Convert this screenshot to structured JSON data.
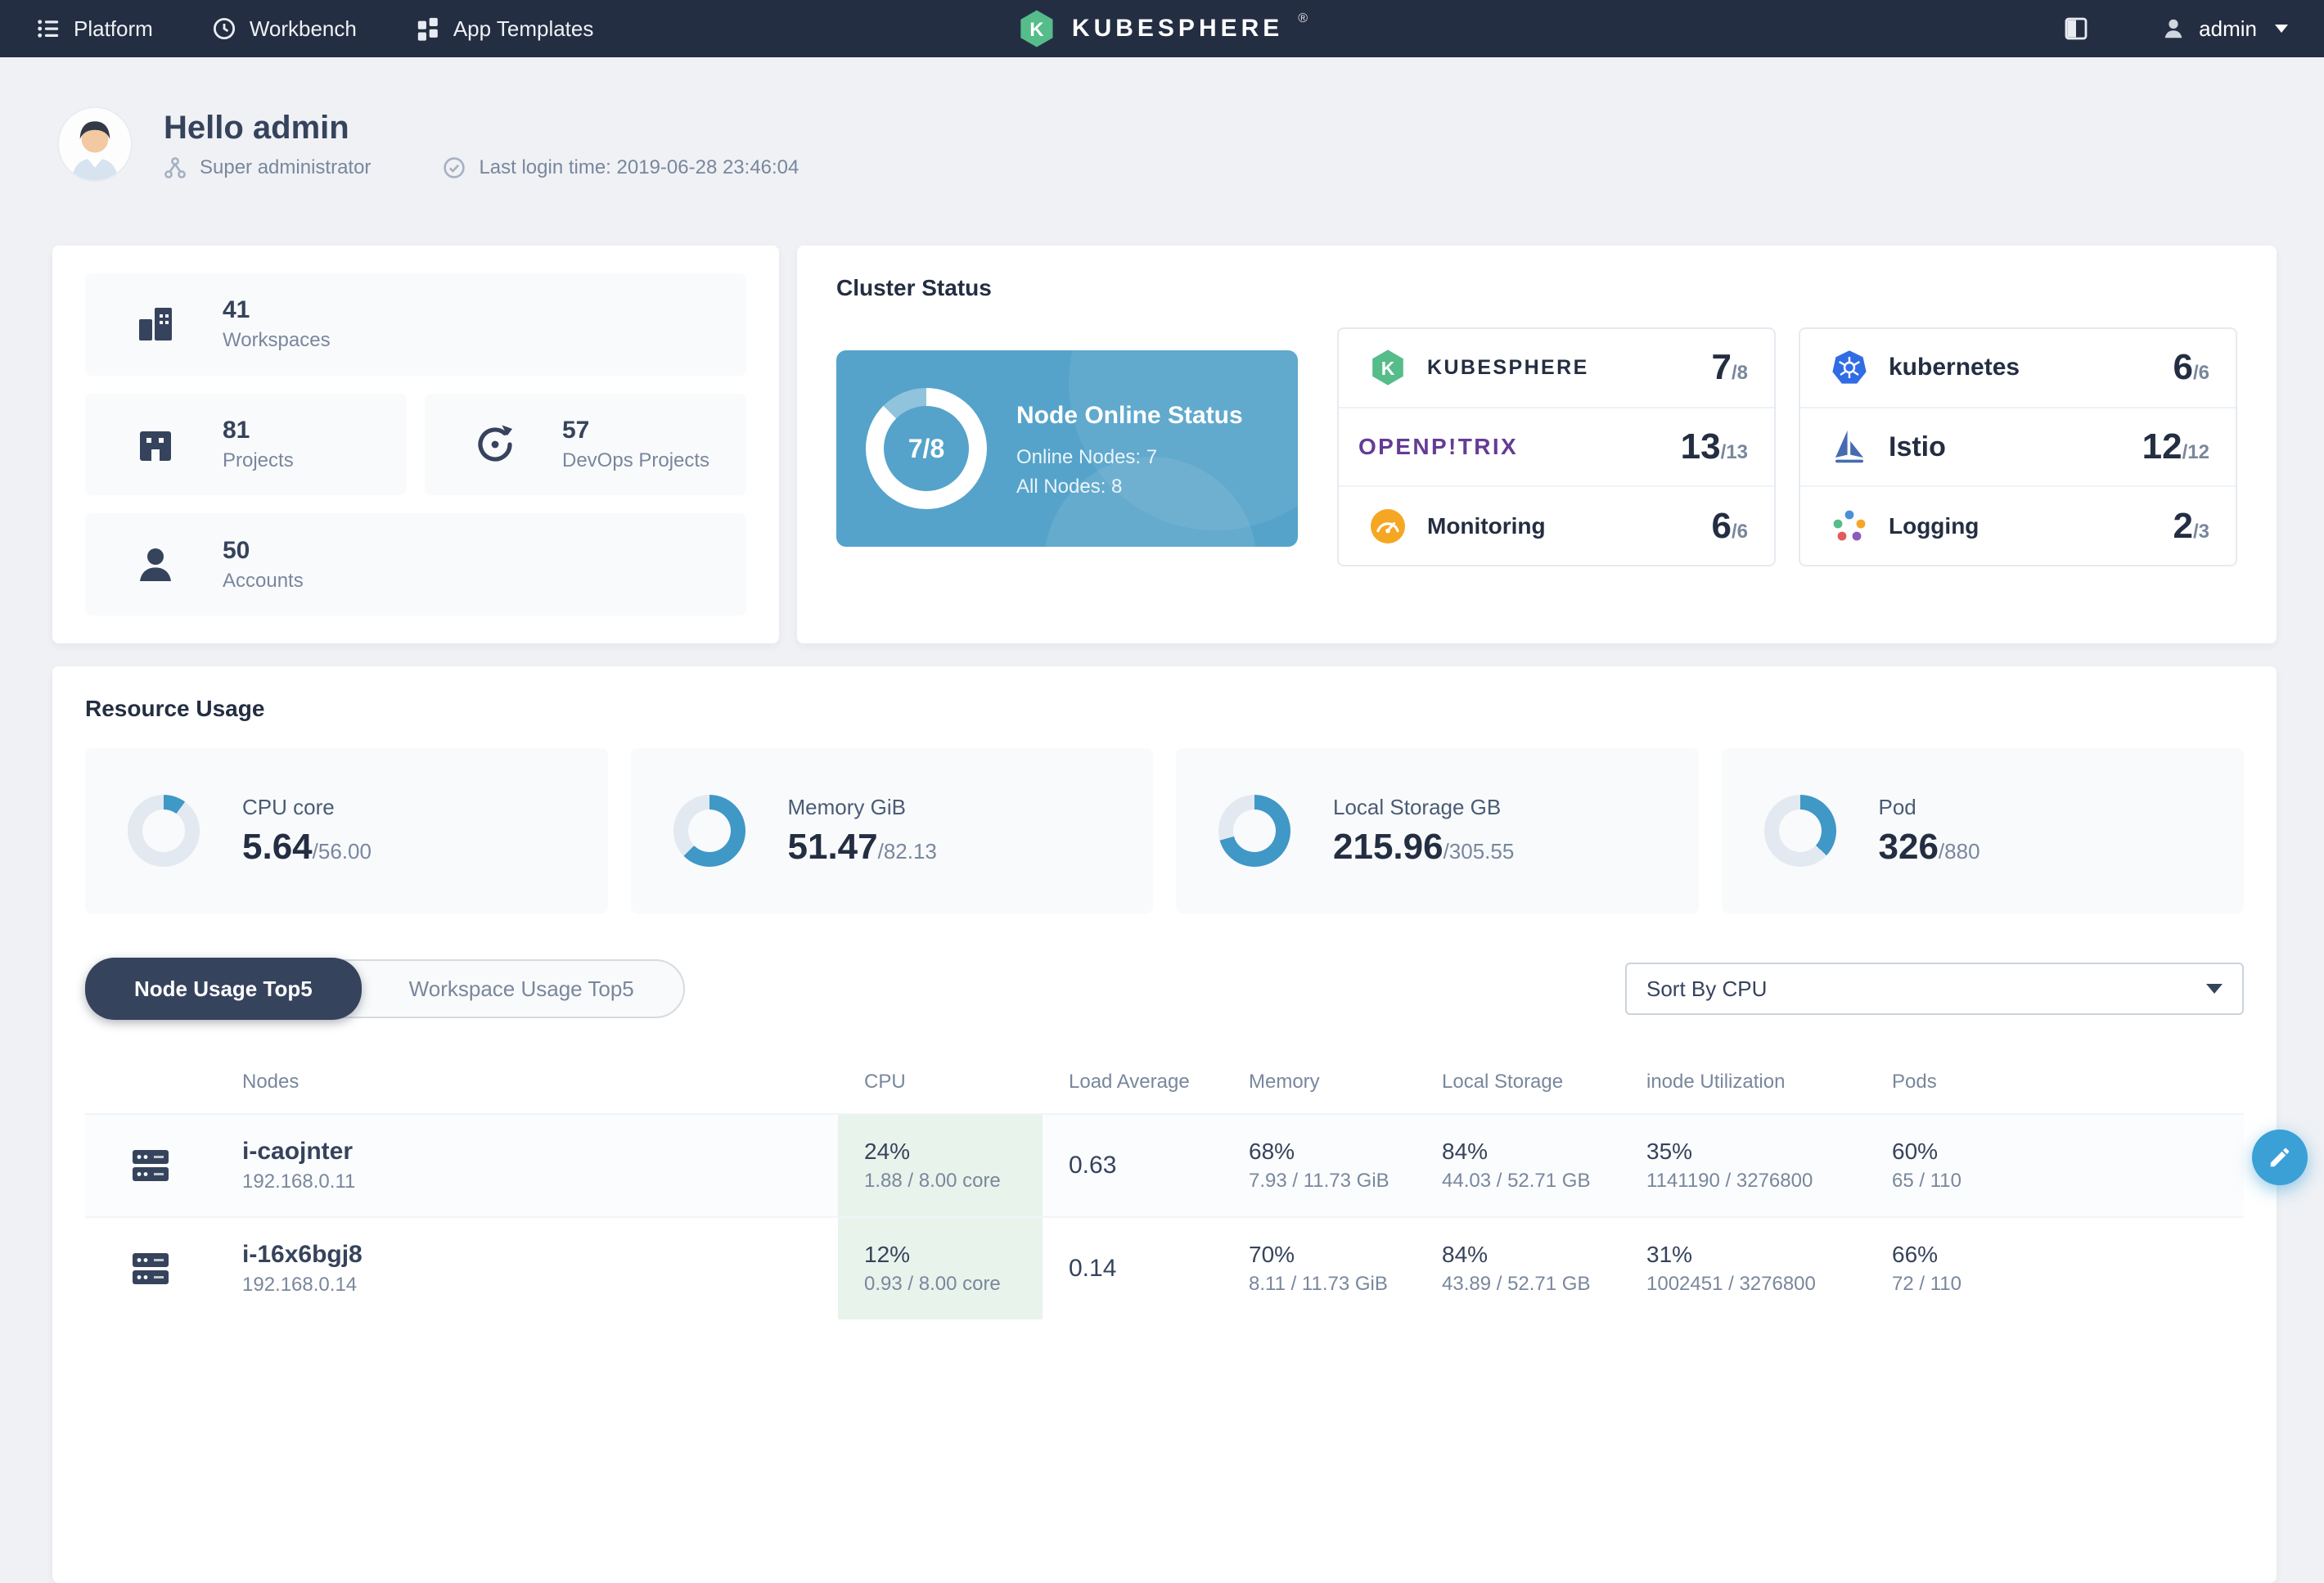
{
  "navbar": {
    "platform": "Platform",
    "workbench": "Workbench",
    "app_templates": "App Templates",
    "brand": "KUBESPHERE",
    "registered": "®",
    "user": "admin"
  },
  "header": {
    "greeting": "Hello admin",
    "role": "Super administrator",
    "last_login": "Last login time: 2019-06-28 23:46:04"
  },
  "stats": {
    "workspaces": {
      "value": "41",
      "label": "Workspaces"
    },
    "projects": {
      "value": "81",
      "label": "Projects"
    },
    "devops": {
      "value": "57",
      "label": "DevOps Projects"
    },
    "accounts": {
      "value": "50",
      "label": "Accounts"
    }
  },
  "cluster": {
    "title": "Cluster Status",
    "node_status": {
      "fraction": "7/8",
      "percent": 87.5,
      "title": "Node Online Status",
      "online_nodes": "Online Nodes: 7",
      "all_nodes": "All Nodes: 8"
    },
    "components": [
      {
        "name": "KUBESPHERE",
        "value": "7",
        "total": "/8"
      },
      {
        "name": "kubernetes",
        "value": "6",
        "total": "/6"
      },
      {
        "name": "OPENP!TRIX",
        "value": "13",
        "total": "/13"
      },
      {
        "name": "Istio",
        "value": "12",
        "total": "/12"
      },
      {
        "name": "Monitoring",
        "value": "6",
        "total": "/6"
      },
      {
        "name": "Logging",
        "value": "2",
        "total": "/3"
      }
    ]
  },
  "resources": {
    "title": "Resource Usage",
    "metrics": [
      {
        "label": "CPU core",
        "value": "5.64",
        "total": "/56.00",
        "percent": 10.1
      },
      {
        "label": "Memory GiB",
        "value": "51.47",
        "total": "/82.13",
        "percent": 62.7
      },
      {
        "label": "Local Storage GB",
        "value": "215.96",
        "total": "/305.55",
        "percent": 70.7
      },
      {
        "label": "Pod",
        "value": "326",
        "total": "/880",
        "percent": 37
      }
    ],
    "tabs": [
      {
        "label": "Node Usage Top5"
      },
      {
        "label": "Workspace Usage Top5"
      }
    ],
    "sort": "Sort By CPU"
  },
  "table": {
    "headers": [
      "Nodes",
      "CPU",
      "Load Average",
      "Memory",
      "Local Storage",
      "inode Utilization",
      "Pods"
    ],
    "rows": [
      {
        "name": "i-caojnter",
        "ip": "192.168.0.11",
        "cpu": "24%",
        "cpu_detail": "1.88 / 8.00 core",
        "load": "0.63",
        "memory": "68%",
        "memory_detail": "7.93 / 11.73 GiB",
        "storage": "84%",
        "storage_detail": "44.03 / 52.71 GB",
        "inode": "35%",
        "inode_detail": "1141190 / 3276800",
        "pods": "60%",
        "pods_detail": "65 / 110"
      },
      {
        "name": "i-16x6bgj8",
        "ip": "192.168.0.14",
        "cpu": "12%",
        "cpu_detail": "0.93 / 8.00 core",
        "load": "0.14",
        "memory": "70%",
        "memory_detail": "8.11 / 11.73 GiB",
        "storage": "84%",
        "storage_detail": "43.89 / 52.71 GB",
        "inode": "31%",
        "inode_detail": "1002451 / 3276800",
        "pods": "66%",
        "pods_detail": "72 / 110"
      }
    ]
  }
}
